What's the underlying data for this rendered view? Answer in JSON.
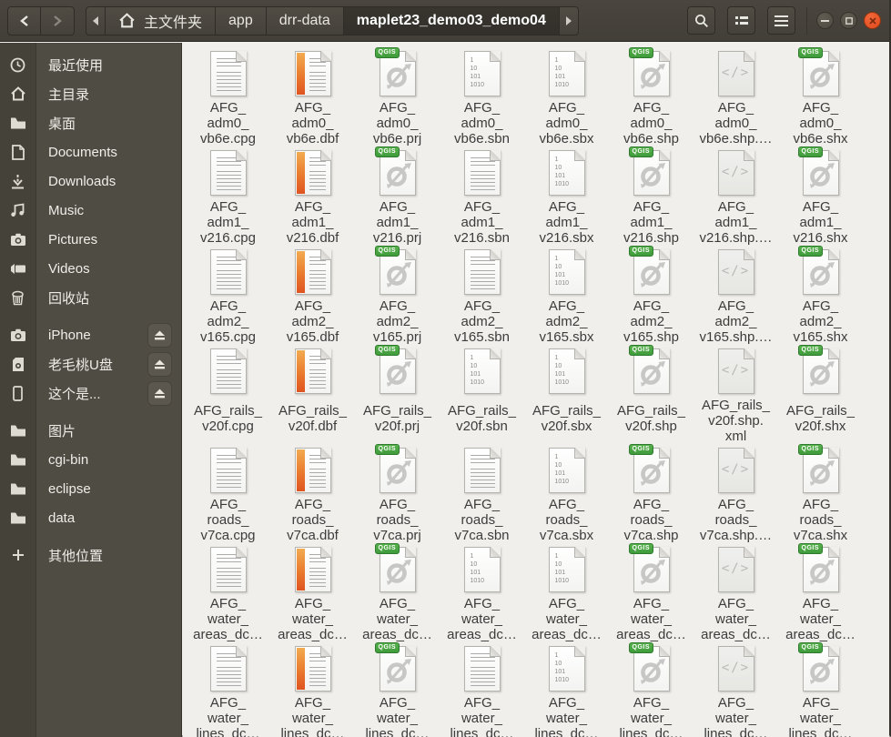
{
  "header": {
    "nav": {
      "back_icon": "chevron-left",
      "forward_icon": "chevron-right"
    },
    "path": {
      "segments": [
        {
          "label": "主文件夹",
          "icon": "home",
          "active": false
        },
        {
          "label": "app",
          "active": false
        },
        {
          "label": "drr-data",
          "active": false
        },
        {
          "label": "maplet23_demo03_demo04",
          "active": true
        }
      ]
    },
    "actions": {
      "search": "search",
      "view_toggle": "list-view",
      "menu": "hamburger"
    },
    "window_controls": {
      "minimize": "minus",
      "maximize": "square",
      "close": "x"
    },
    "colors": {
      "close_button": "#e85420",
      "bar_bg": "#44413a"
    }
  },
  "sidebar": {
    "items": [
      {
        "id": "recent",
        "icon": "clock",
        "label": "最近使用"
      },
      {
        "id": "home",
        "icon": "home",
        "label": "主目录"
      },
      {
        "id": "desktop",
        "icon": "folder",
        "label": "桌面"
      },
      {
        "id": "documents",
        "icon": "document",
        "label": "Documents"
      },
      {
        "id": "downloads",
        "icon": "download",
        "label": "Downloads"
      },
      {
        "id": "music",
        "icon": "music",
        "label": "Music"
      },
      {
        "id": "pictures",
        "icon": "camera",
        "label": "Pictures"
      },
      {
        "id": "videos",
        "icon": "video",
        "label": "Videos"
      },
      {
        "id": "trash",
        "icon": "trash",
        "label": "回收站"
      },
      {
        "id": "iphone",
        "icon": "camera",
        "label": "iPhone",
        "eject": true,
        "gap": true
      },
      {
        "id": "usb-drive",
        "icon": "sdcard",
        "label": "老毛桃U盘",
        "eject": true
      },
      {
        "id": "mobile-device",
        "icon": "phone",
        "label": "这个是...",
        "eject": true
      },
      {
        "id": "pictures-folder",
        "icon": "folder",
        "label": "图片",
        "gap": true
      },
      {
        "id": "cgi-bin",
        "icon": "folder",
        "label": "cgi-bin"
      },
      {
        "id": "eclipse",
        "icon": "folder",
        "label": "eclipse"
      },
      {
        "id": "data",
        "icon": "folder",
        "label": "data"
      },
      {
        "id": "other-locations",
        "icon": "plus",
        "label": "其他位置",
        "gap": true
      }
    ]
  },
  "icons_art": {
    "binary_lines": [
      "1",
      "10",
      "101",
      "1010"
    ],
    "qgis_badge": "QGIS",
    "code_glyph": "</>"
  },
  "files": {
    "rows": [
      {
        "cells": [
          {
            "icon": "text",
            "lines": [
              "AFG_",
              "adm0_",
              "vb6e.cpg"
            ]
          },
          {
            "icon": "dbf",
            "lines": [
              "AFG_",
              "adm0_",
              "vb6e.dbf"
            ]
          },
          {
            "icon": "qgis",
            "lines": [
              "AFG_",
              "adm0_",
              "vb6e.prj"
            ]
          },
          {
            "icon": "binary",
            "lines": [
              "AFG_",
              "adm0_",
              "vb6e.sbn"
            ]
          },
          {
            "icon": "binary",
            "lines": [
              "AFG_",
              "adm0_",
              "vb6e.sbx"
            ]
          },
          {
            "icon": "qgis",
            "lines": [
              "AFG_",
              "adm0_",
              "vb6e.shp"
            ]
          },
          {
            "icon": "code",
            "lines": [
              "AFG_",
              "adm0_",
              "vb6e.shp.…"
            ]
          },
          {
            "icon": "qgis",
            "lines": [
              "AFG_",
              "adm0_",
              "vb6e.shx"
            ]
          }
        ]
      },
      {
        "cells": [
          {
            "icon": "text",
            "lines": [
              "AFG_",
              "adm1_",
              "v216.cpg"
            ]
          },
          {
            "icon": "dbf",
            "lines": [
              "AFG_",
              "adm1_",
              "v216.dbf"
            ]
          },
          {
            "icon": "qgis",
            "lines": [
              "AFG_",
              "adm1_",
              "v216.prj"
            ]
          },
          {
            "icon": "text",
            "lines": [
              "AFG_",
              "adm1_",
              "v216.sbn"
            ]
          },
          {
            "icon": "binary",
            "lines": [
              "AFG_",
              "adm1_",
              "v216.sbx"
            ]
          },
          {
            "icon": "qgis",
            "lines": [
              "AFG_",
              "adm1_",
              "v216.shp"
            ]
          },
          {
            "icon": "code",
            "lines": [
              "AFG_",
              "adm1_",
              "v216.shp.…"
            ]
          },
          {
            "icon": "qgis",
            "lines": [
              "AFG_",
              "adm1_",
              "v216.shx"
            ]
          }
        ]
      },
      {
        "cells": [
          {
            "icon": "text",
            "lines": [
              "AFG_",
              "adm2_",
              "v165.cpg"
            ]
          },
          {
            "icon": "dbf",
            "lines": [
              "AFG_",
              "adm2_",
              "v165.dbf"
            ]
          },
          {
            "icon": "qgis",
            "lines": [
              "AFG_",
              "adm2_",
              "v165.prj"
            ]
          },
          {
            "icon": "text",
            "lines": [
              "AFG_",
              "adm2_",
              "v165.sbn"
            ]
          },
          {
            "icon": "binary",
            "lines": [
              "AFG_",
              "adm2_",
              "v165.sbx"
            ]
          },
          {
            "icon": "qgis",
            "lines": [
              "AFG_",
              "adm2_",
              "v165.shp"
            ]
          },
          {
            "icon": "code",
            "lines": [
              "AFG_",
              "adm2_",
              "v165.shp.…"
            ]
          },
          {
            "icon": "qgis",
            "lines": [
              "AFG_",
              "adm2_",
              "v165.shx"
            ]
          }
        ]
      },
      {
        "cells": [
          {
            "icon": "text",
            "lines": [
              "AFG_rails_",
              "v20f.cpg"
            ]
          },
          {
            "icon": "dbf",
            "lines": [
              "AFG_rails_",
              "v20f.dbf"
            ]
          },
          {
            "icon": "qgis",
            "lines": [
              "AFG_rails_",
              "v20f.prj"
            ]
          },
          {
            "icon": "binary",
            "lines": [
              "AFG_rails_",
              "v20f.sbn"
            ]
          },
          {
            "icon": "binary",
            "lines": [
              "AFG_rails_",
              "v20f.sbx"
            ]
          },
          {
            "icon": "qgis",
            "lines": [
              "AFG_rails_",
              "v20f.shp"
            ]
          },
          {
            "icon": "code",
            "lines": [
              "AFG_rails_",
              "v20f.shp.",
              "xml"
            ]
          },
          {
            "icon": "qgis",
            "lines": [
              "AFG_rails_",
              "v20f.shx"
            ]
          }
        ]
      },
      {
        "cells": [
          {
            "icon": "text",
            "lines": [
              "AFG_",
              "roads_",
              "v7ca.cpg"
            ]
          },
          {
            "icon": "dbf",
            "lines": [
              "AFG_",
              "roads_",
              "v7ca.dbf"
            ]
          },
          {
            "icon": "qgis",
            "lines": [
              "AFG_",
              "roads_",
              "v7ca.prj"
            ]
          },
          {
            "icon": "text",
            "lines": [
              "AFG_",
              "roads_",
              "v7ca.sbn"
            ]
          },
          {
            "icon": "binary",
            "lines": [
              "AFG_",
              "roads_",
              "v7ca.sbx"
            ]
          },
          {
            "icon": "qgis",
            "lines": [
              "AFG_",
              "roads_",
              "v7ca.shp"
            ]
          },
          {
            "icon": "code",
            "lines": [
              "AFG_",
              "roads_",
              "v7ca.shp.…"
            ]
          },
          {
            "icon": "qgis",
            "lines": [
              "AFG_",
              "roads_",
              "v7ca.shx"
            ]
          }
        ]
      },
      {
        "cells": [
          {
            "icon": "text",
            "lines": [
              "AFG_",
              "water_",
              "areas_dc…"
            ]
          },
          {
            "icon": "dbf",
            "lines": [
              "AFG_",
              "water_",
              "areas_dc…"
            ]
          },
          {
            "icon": "qgis",
            "lines": [
              "AFG_",
              "water_",
              "areas_dc…"
            ]
          },
          {
            "icon": "binary",
            "lines": [
              "AFG_",
              "water_",
              "areas_dc…"
            ]
          },
          {
            "icon": "binary",
            "lines": [
              "AFG_",
              "water_",
              "areas_dc…"
            ]
          },
          {
            "icon": "qgis",
            "lines": [
              "AFG_",
              "water_",
              "areas_dc…"
            ]
          },
          {
            "icon": "code",
            "lines": [
              "AFG_",
              "water_",
              "areas_dc…"
            ]
          },
          {
            "icon": "qgis",
            "lines": [
              "AFG_",
              "water_",
              "areas_dc…"
            ]
          }
        ]
      },
      {
        "cells": [
          {
            "icon": "text",
            "lines": [
              "AFG_",
              "water_",
              "lines_dc…"
            ]
          },
          {
            "icon": "dbf",
            "lines": [
              "AFG_",
              "water_",
              "lines_dc…"
            ]
          },
          {
            "icon": "qgis",
            "lines": [
              "AFG_",
              "water_",
              "lines_dc…"
            ]
          },
          {
            "icon": "text",
            "lines": [
              "AFG_",
              "water_",
              "lines_dc…"
            ]
          },
          {
            "icon": "binary",
            "lines": [
              "AFG_",
              "water_",
              "lines_dc…"
            ]
          },
          {
            "icon": "qgis",
            "lines": [
              "AFG_",
              "water_",
              "lines_dc…"
            ]
          },
          {
            "icon": "code",
            "lines": [
              "AFG_",
              "water_",
              "lines_dc…"
            ]
          },
          {
            "icon": "qgis",
            "lines": [
              "AFG_",
              "water_",
              "lines_dc…"
            ]
          }
        ]
      }
    ]
  }
}
